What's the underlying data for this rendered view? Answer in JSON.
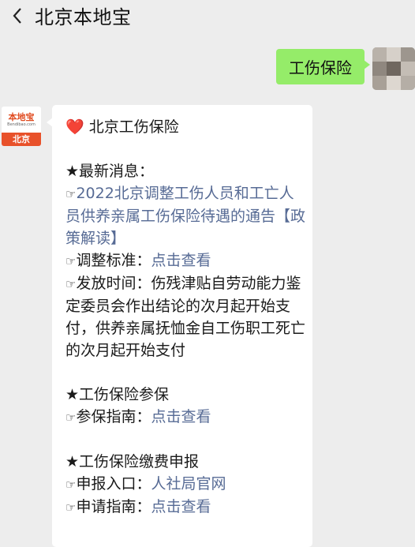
{
  "header": {
    "back_glyph": "‹",
    "title": "北京本地宝"
  },
  "outgoing": {
    "text": "工伤保险"
  },
  "bot_avatar": {
    "name": "本地宝",
    "url": "Bendibao.com",
    "city": "北京"
  },
  "message": {
    "heading_icon": "❤️",
    "heading": "北京工伤保险",
    "s1_title": "★最新消息：",
    "s1_hand": "☞",
    "s1_link": "2022北京调整工伤人员和工亡人员供养亲属工伤保险待遇的通告【政策解读】",
    "s1_l2_hand": "☞",
    "s1_l2_label": "调整标准：",
    "s1_l2_link": "点击查看",
    "s1_l3_hand": "☞",
    "s1_l3_text": "发放时间：伤残津贴自劳动能力鉴定委员会作出结论的次月起开始支付，供养亲属抚恤金自工伤职工死亡的次月起开始支付",
    "s2_title": "★工伤保险参保",
    "s2_hand": "☞",
    "s2_label": "参保指南：",
    "s2_link": "点击查看",
    "s3_title": "★工伤保险缴费申报",
    "s3_l1_hand": "☞",
    "s3_l1_label": "申报入口：",
    "s3_l1_link": "人社局官网",
    "s3_l2_hand": "☞",
    "s3_l2_label": "申请指南：",
    "s3_l2_link": "点击查看"
  }
}
